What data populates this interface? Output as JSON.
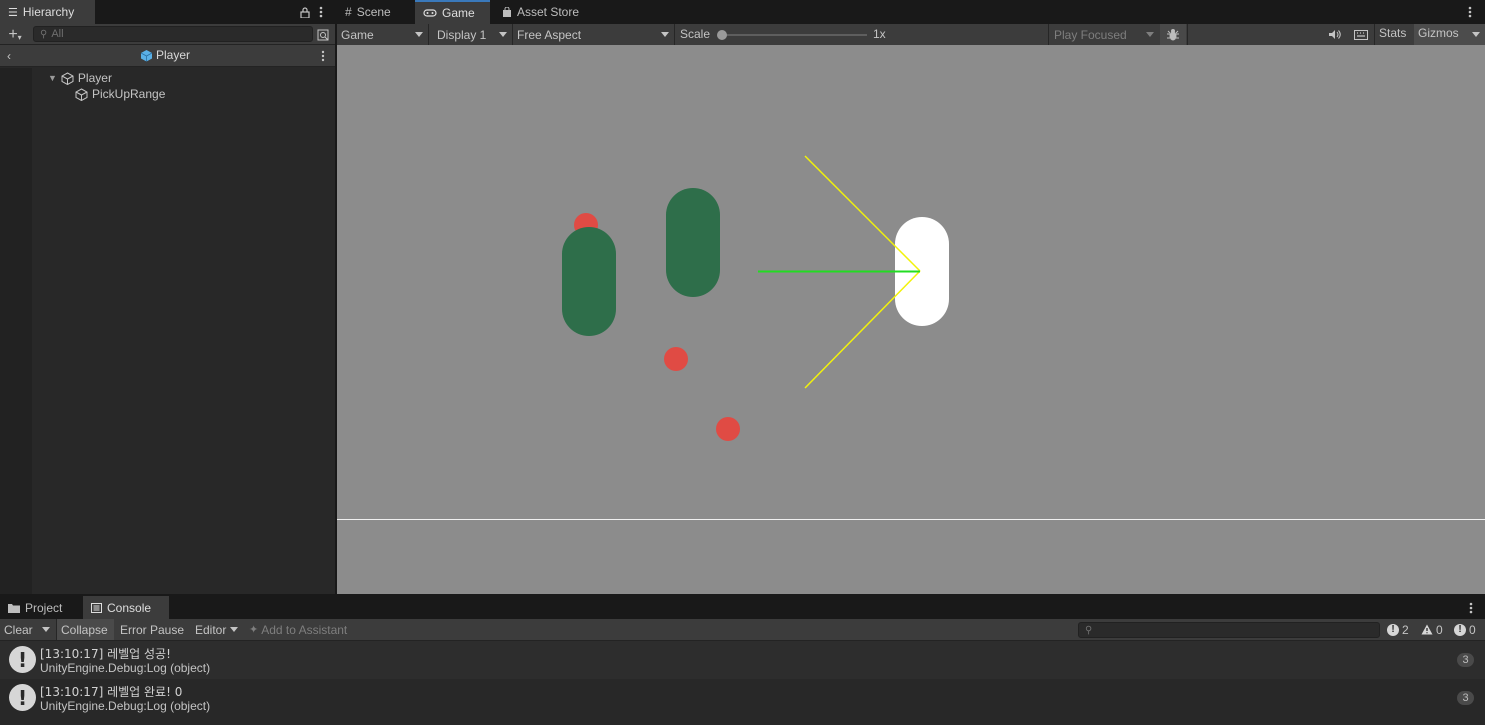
{
  "hierarchy": {
    "tab_label": "Hierarchy",
    "search_placeholder": "All",
    "scene_title": "Player",
    "tree": [
      {
        "label": "Player",
        "expanded": true,
        "depth": 0
      },
      {
        "label": "PickUpRange",
        "depth": 1
      }
    ]
  },
  "game_tabs": [
    {
      "label": "Scene",
      "icon": "grid-icon"
    },
    {
      "label": "Game",
      "icon": "gamepad-icon",
      "active": true
    },
    {
      "label": "Asset Store",
      "icon": "shopping-bag-icon"
    }
  ],
  "game_toolbar": {
    "view_mode": "Game",
    "display": "Display 1",
    "aspect": "Free Aspect",
    "scale_label": "Scale",
    "scale_value": "1x",
    "scale_fraction": 0.0,
    "play_mode": "Play Focused",
    "stats_label": "Stats",
    "gizmos_label": "Gizmos"
  },
  "bottom_tabs": [
    {
      "label": "Project",
      "icon": "folder-icon"
    },
    {
      "label": "Console",
      "icon": "console-icon",
      "active": true
    }
  ],
  "console_toolbar": {
    "clear_label": "Clear",
    "collapse_label": "Collapse",
    "error_pause_label": "Error Pause",
    "editor_label": "Editor",
    "assistant_label": "Add to Assistant",
    "info_count": "2",
    "warning_count": "0",
    "error_count": "0"
  },
  "console_logs": [
    {
      "line1": "[13:10:17] 레벨업 성공!",
      "line2": "UnityEngine.Debug:Log (object)",
      "count": "3"
    },
    {
      "line1": "[13:10:17] 레벨업 완료! 0",
      "line2": "UnityEngine.Debug:Log (object)",
      "count": "3"
    }
  ],
  "colors": {
    "accent": "#3a79bb",
    "game_bg": "#8c8c8c",
    "enemy_green": "#2e6e4a",
    "player_white": "#ffffff",
    "pickup_red": "#e04b44",
    "ray_yellow": "#ffff00",
    "ray_green": "#22dd22"
  }
}
